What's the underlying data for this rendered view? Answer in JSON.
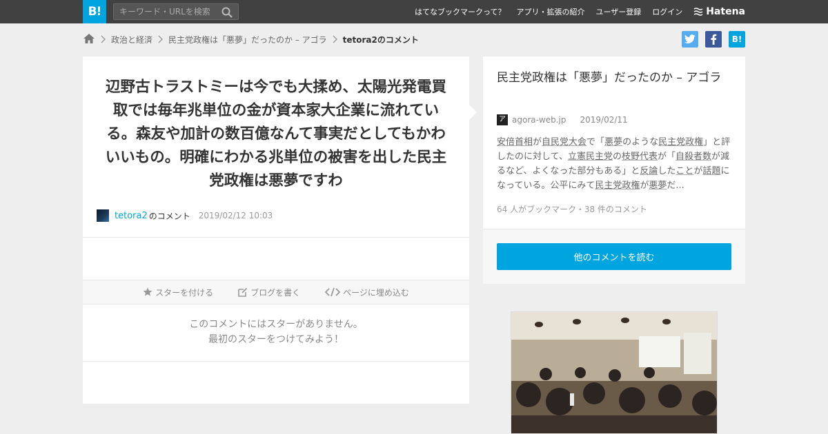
{
  "topbar": {
    "logo": "B!",
    "search_placeholder": "キーワード・URLを検索",
    "nav": [
      "はてなブックマークって？",
      "アプリ・拡張の紹介",
      "ユーザー登録",
      "ログイン"
    ],
    "hatena": "Hatena"
  },
  "breadcrumb": {
    "items": [
      "政治と経済",
      "民主党政権は「悪夢」だったのか – アゴラ"
    ],
    "current": "tetora2のコメント"
  },
  "share": {
    "twitter_color": "#55acee",
    "facebook_color": "#3b5998",
    "hatena_color": "#00a4de",
    "hatena_label": "B!"
  },
  "comment": {
    "text": "辺野古トラストミーは今でも大揉め、太陽光発電買取では毎年兆単位の金が資本家大企業に流れている。森友や加計の数百億なんて事実だとしてもかわいいもの。明確にわかる兆単位の被害を出した民主党政権は悪夢ですわ",
    "user": "tetora2",
    "suffix": "のコメント",
    "date": "2019/02/12 10:03"
  },
  "actions": {
    "star": "スターを付ける",
    "blog": "ブログを書く",
    "embed": "ページに埋め込む"
  },
  "nostar": {
    "line1": "このコメントにはスターがありません。",
    "line2": "最初のスターをつけてみよう！"
  },
  "entry": {
    "title": "民主党政権は「悪夢」だったのか – アゴラ",
    "site": "agora-web.jp",
    "favicon": "ア",
    "date": "2019/02/11",
    "excerpt_parts": [
      "安倍首相",
      "が",
      "自民党大会",
      "で「",
      "悪夢",
      "のような",
      "民主党政権",
      "」と評したのに対して、",
      "立憲民主党",
      "の",
      "枝野代表",
      "が「",
      "自殺者数",
      "が減るなど、よくなった部分もある」と",
      "反論",
      "した",
      "こと",
      "が",
      "話題",
      "になっている。公平にみて",
      "民主党政権",
      "が",
      "悪夢",
      "だ..."
    ],
    "counts": "64 人がブックマーク・38 件のコメント",
    "read_more": "他のコメントを読む"
  },
  "colors": {
    "accent": "#00a4de",
    "topbar": "#414141",
    "background": "#eeeeee"
  }
}
